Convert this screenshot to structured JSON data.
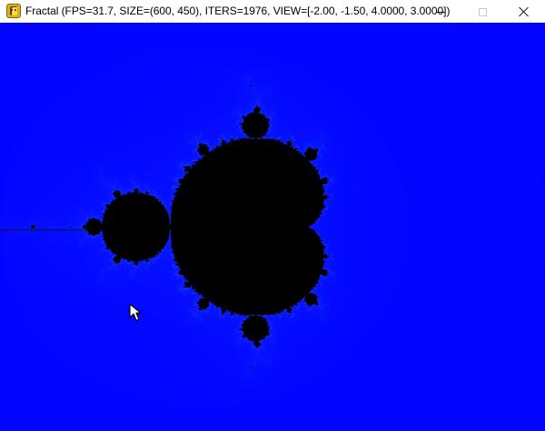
{
  "window": {
    "title": "Fractal (FPS=31.7, SIZE=(600, 450), ITERS=1976, VIEW=[-2.00, -1.50, 4.0000, 3.0000])",
    "icon": "pygame-snake-icon",
    "controls": {
      "minimize": "minimize-icon",
      "maximize": "maximize-icon",
      "close": "close-icon"
    }
  },
  "render": {
    "fps": 31.7,
    "size": [
      600,
      450
    ],
    "iterations": 1976,
    "view": [
      -2.0,
      -1.5,
      4.0,
      3.0
    ],
    "colors": {
      "background": "#0000ff",
      "set": "#000000",
      "glow": "#4f66ff",
      "line": "#141414"
    }
  },
  "cursor": {
    "icon": "mouse-pointer-icon"
  }
}
